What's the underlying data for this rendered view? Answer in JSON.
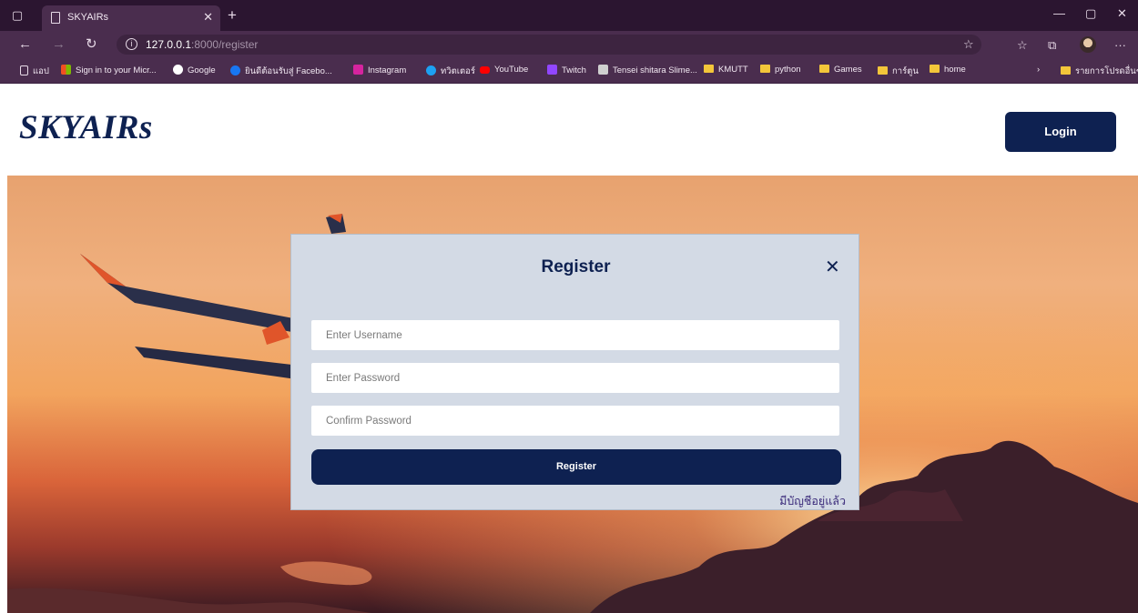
{
  "browser": {
    "tab_title": "SKYAIRs",
    "new_tab": "+",
    "address_host": "127.0.0.1",
    "address_path": ":8000/register",
    "bookmarks": [
      {
        "label": "แอป",
        "color": "#ffffff"
      },
      {
        "label": "Sign in to your Micr...",
        "color": "#f25022"
      },
      {
        "label": "Google",
        "color": "#4285f4"
      },
      {
        "label": "ยินดีต้อนรับสู่ Facebo...",
        "color": "#1877f2"
      },
      {
        "label": "Instagram",
        "color": "#d6249f"
      },
      {
        "label": "ทวิตเตอร์",
        "color": "#1da1f2"
      },
      {
        "label": "YouTube",
        "color": "#ff0000"
      },
      {
        "label": "Twitch",
        "color": "#9146ff"
      },
      {
        "label": "Tensei shitara Slime...",
        "color": "#cfcfcf"
      },
      {
        "label": "KMUTT",
        "color": "#f3c63a"
      },
      {
        "label": "python",
        "color": "#f3c63a"
      },
      {
        "label": "Games",
        "color": "#f3c63a"
      },
      {
        "label": "การ์ตูน",
        "color": "#f3c63a"
      },
      {
        "label": "home",
        "color": "#f3c63a"
      }
    ],
    "other_bookmarks": "รายการโปรดอื่นๆ"
  },
  "header": {
    "logo": "SKYAIRs",
    "login_label": "Login"
  },
  "modal": {
    "title": "Register",
    "username_placeholder": "Enter Username",
    "password_placeholder": "Enter Password",
    "confirm_placeholder": "Confirm Password",
    "register_label": "Register",
    "have_account_link": "มีบัญชีอยู่แล้ว"
  },
  "colors": {
    "brand": "#0e2151",
    "modal_bg": "#d3dae5",
    "browser_frame": "#4a2d4e"
  }
}
